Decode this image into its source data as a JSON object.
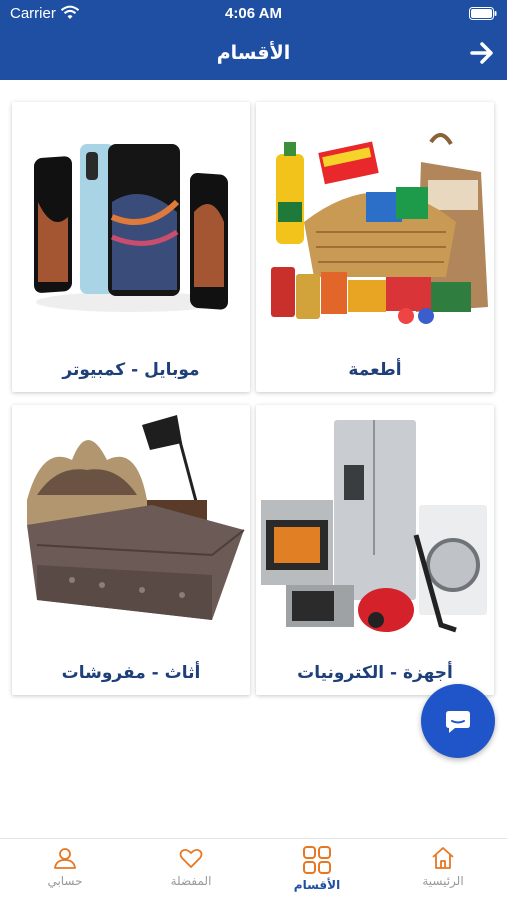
{
  "status_bar": {
    "carrier": "Carrier",
    "time": "4:06 AM"
  },
  "header": {
    "title": "الأقسام",
    "back_icon": "arrow-right-icon"
  },
  "categories": [
    {
      "label": "أطعمة",
      "image": "groceries-basket"
    },
    {
      "label": "موبايل - كمبيوتر",
      "image": "mobile-phones"
    },
    {
      "label": "أجهزة - الكترونيات",
      "image": "home-appliances"
    },
    {
      "label": "أثاث - مفروشات",
      "image": "bed-furniture"
    }
  ],
  "chat_button": {
    "icon": "chat-bubble-icon"
  },
  "tab_bar": {
    "items": [
      {
        "label": "الرئيسية",
        "icon": "home-icon",
        "active": false
      },
      {
        "label": "الأقسام",
        "icon": "grid-icon",
        "active": true
      },
      {
        "label": "المفضلة",
        "icon": "heart-icon",
        "active": false
      },
      {
        "label": "حسابي",
        "icon": "user-icon",
        "active": false
      }
    ]
  },
  "colors": {
    "primary": "#1e4fa3",
    "active_tab": "#e87722",
    "label": "#1e3f7a",
    "fab": "#1f55c8"
  }
}
